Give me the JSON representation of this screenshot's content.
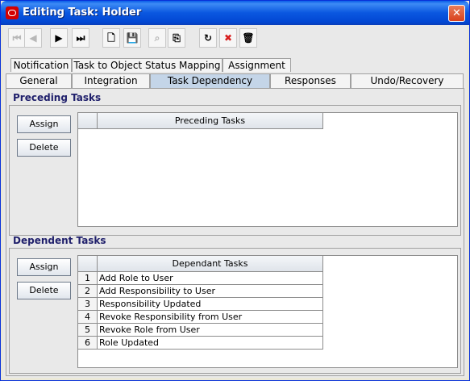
{
  "window": {
    "title": "Editing Task: Holder",
    "close_glyph": "✕"
  },
  "toolbar": {
    "buttons": [
      {
        "name": "first-record-button",
        "icon": "first-record-icon",
        "glyph": "⏮",
        "enabled": false
      },
      {
        "name": "previous-record-button",
        "icon": "previous-record-icon",
        "glyph": "◀",
        "enabled": false
      },
      {
        "name": "next-record-button",
        "icon": "next-record-icon",
        "glyph": "▶",
        "enabled": true
      },
      {
        "name": "last-record-button",
        "icon": "last-record-icon",
        "glyph": "⏭",
        "enabled": true
      },
      {
        "name": "new-button",
        "icon": "new-document-icon",
        "glyph": "🗋",
        "enabled": true
      },
      {
        "name": "save-button",
        "icon": "save-icon",
        "glyph": "💾",
        "enabled": true
      },
      {
        "name": "find-button",
        "icon": "binoculars-icon",
        "glyph": "⌕",
        "enabled": false
      },
      {
        "name": "assign-button",
        "icon": "assign-icon",
        "glyph": "⎘",
        "enabled": true
      },
      {
        "name": "refresh-button",
        "icon": "refresh-icon",
        "glyph": "↻",
        "enabled": true
      },
      {
        "name": "cancel-button",
        "icon": "red-x-icon",
        "glyph": "✖",
        "enabled": true,
        "color": "#d81e1e"
      },
      {
        "name": "delete-button",
        "icon": "trash-icon",
        "glyph": "🗑",
        "enabled": true
      }
    ]
  },
  "tabs": {
    "row1": [
      "Notification",
      "Task to Object Status Mapping",
      "Assignment"
    ],
    "row2": [
      "General",
      "Integration",
      "Task Dependency",
      "Responses",
      "Undo/Recovery"
    ],
    "active": "Task Dependency"
  },
  "preceding": {
    "title": "Preceding Tasks",
    "assign_label": "Assign",
    "delete_label": "Delete",
    "column": "Preceding Tasks",
    "rows": []
  },
  "dependent": {
    "title": "Dependent Tasks",
    "assign_label": "Assign",
    "delete_label": "Delete",
    "column": "Dependant Tasks",
    "rows": [
      {
        "num": "1",
        "task": "Add Role to User"
      },
      {
        "num": "2",
        "task": "Add Responsibility to User"
      },
      {
        "num": "3",
        "task": "Responsibility Updated"
      },
      {
        "num": "4",
        "task": "Revoke Responsibility from User"
      },
      {
        "num": "5",
        "task": "Revoke Role from User"
      },
      {
        "num": "6",
        "task": "Role Updated"
      }
    ]
  },
  "colors": {
    "titlebar": "#0a57e0",
    "active_tab": "#c4d5e8",
    "group_title": "#1f1f6b"
  }
}
